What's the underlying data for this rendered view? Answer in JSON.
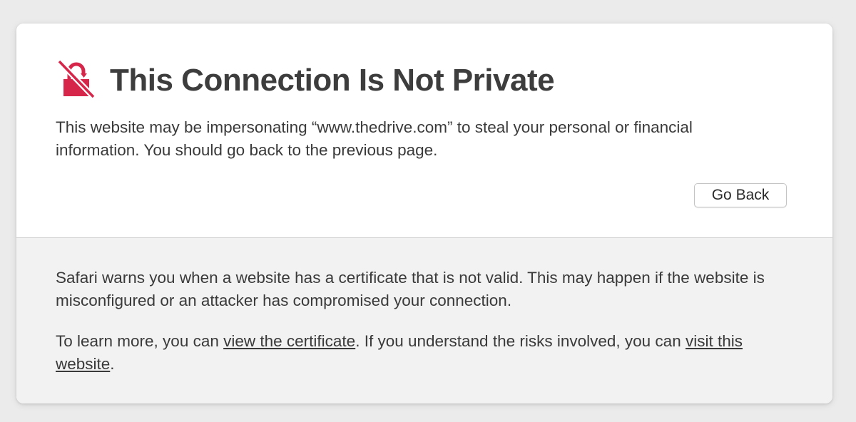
{
  "error_page": {
    "icon": "broken-lock-icon",
    "accent_color": "#d6264a",
    "title": "This Connection Is Not Private",
    "description": "This website may be impersonating “www.thedrive.com” to steal your personal or financial information. You should go back to the previous page.",
    "go_back_label": "Go Back"
  },
  "details": {
    "warning_text": "Safari warns you when a website has a certificate that is not valid. This may happen if the website is misconfigured or an attacker has compromised your connection.",
    "learn_more_prefix": "To learn more, you can ",
    "view_certificate_link": "view the certificate",
    "learn_more_middle": ". If you understand the risks involved, you can ",
    "visit_website_link": "visit this website",
    "learn_more_suffix": "."
  }
}
